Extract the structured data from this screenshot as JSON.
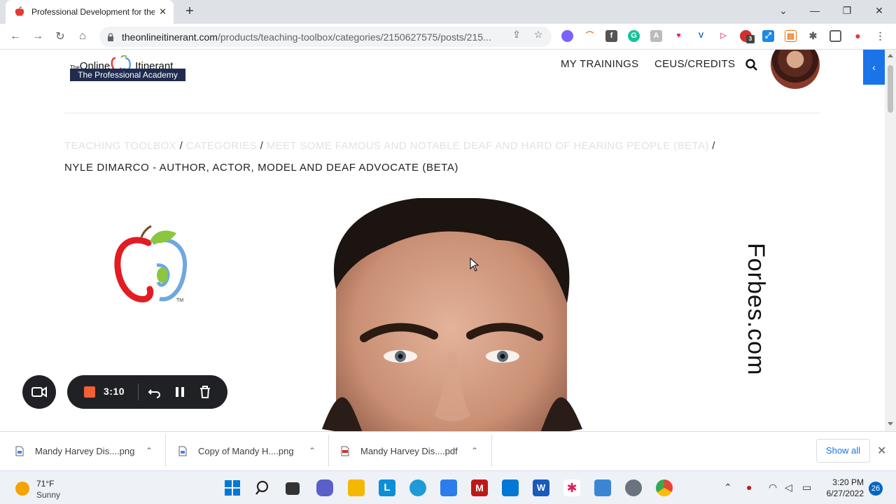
{
  "browser": {
    "tab_title": "Professional Development for the",
    "url_host": "theonlineitinerant.com",
    "url_path": "/products/teaching-toolbox/categories/2150627575/posts/215...",
    "extension_badge": "3"
  },
  "site": {
    "logo_prefix": "The",
    "logo_name_1": "Online",
    "logo_name_2": "Itinerant",
    "logo_band": "The Professional Academy",
    "nav": [
      "MY TRAININGS",
      "CEUS/CREDITS"
    ]
  },
  "breadcrumb": {
    "items": [
      "TEACHING TOOLBOX",
      "CATEGORIES",
      "MEET SOME FAMOUS AND NOTABLE DEAF AND HARD OF HEARING PEOPLE (BETA)"
    ],
    "separator": "/",
    "current": "NYLE DIMARCO - AUTHOR, ACTOR, MODEL AND DEAF ADVOCATE (BETA)"
  },
  "content": {
    "forbes_credit": "Forbes.com",
    "logo_tm": "TM"
  },
  "recorder": {
    "time": "3:10"
  },
  "downloads": {
    "items": [
      "Mandy Harvey Dis....png",
      "Copy of Mandy H....png",
      "Mandy Harvey Dis....pdf"
    ],
    "show_all": "Show all"
  },
  "taskbar": {
    "temp": "71°F",
    "condition": "Sunny",
    "time": "3:20 PM",
    "date": "6/27/2022",
    "notifications": "26"
  },
  "colors": {
    "accent": "#1a73e8",
    "logo_band": "#1f2c4f",
    "record_red": "#f26035"
  }
}
